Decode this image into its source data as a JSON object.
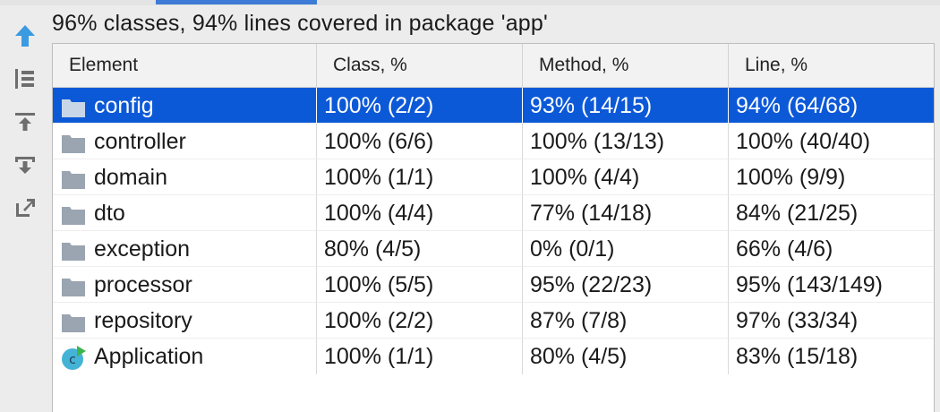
{
  "summary": "96% classes, 94% lines covered in package 'app'",
  "toolbar": {
    "icons": [
      "go-up-icon",
      "flatten-packages-icon",
      "import-icon",
      "export-icon",
      "generate-report-icon"
    ]
  },
  "table": {
    "headers": [
      "Element",
      "Class, %",
      "Method, %",
      "Line, %"
    ],
    "rows": [
      {
        "name": "config",
        "icon": "folder-icon",
        "selected": true,
        "class": "100% (2/2)",
        "method": "93% (14/15)",
        "line": "94% (64/68)"
      },
      {
        "name": "controller",
        "icon": "folder-icon",
        "class": "100% (6/6)",
        "method": "100% (13/13)",
        "line": "100% (40/40)"
      },
      {
        "name": "domain",
        "icon": "folder-icon",
        "class": "100% (1/1)",
        "method": "100% (4/4)",
        "line": "100% (9/9)"
      },
      {
        "name": "dto",
        "icon": "folder-icon",
        "class": "100% (4/4)",
        "method": "77% (14/18)",
        "line": "84% (21/25)"
      },
      {
        "name": "exception",
        "icon": "folder-icon",
        "class": "80% (4/5)",
        "method": "0% (0/1)",
        "line": "66% (4/6)"
      },
      {
        "name": "processor",
        "icon": "folder-icon",
        "class": "100% (5/5)",
        "method": "95% (22/23)",
        "line": "95% (143/149)"
      },
      {
        "name": "repository",
        "icon": "folder-icon",
        "class": "100% (2/2)",
        "method": "87% (7/8)",
        "line": "97% (33/34)"
      },
      {
        "name": "Application",
        "icon": "class-icon",
        "class": "100% (1/1)",
        "method": "80% (4/5)",
        "line": "83% (15/18)"
      }
    ]
  },
  "colors": {
    "selection": "#0c59d8",
    "accent": "#3d7bd6",
    "folder": "#9aa5b1",
    "class_icon": "#45b3d6",
    "run_marker": "#3db54a"
  }
}
